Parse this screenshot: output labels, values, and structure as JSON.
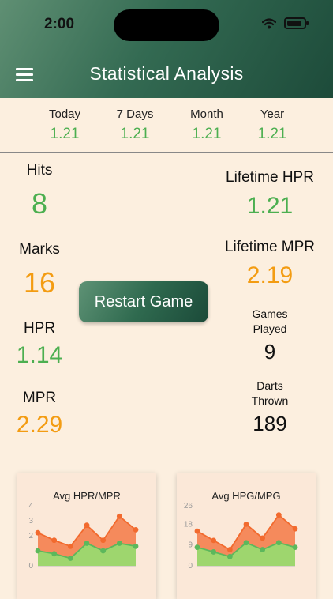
{
  "status": {
    "time": "2:00"
  },
  "header": {
    "title": "Statistical Analysis"
  },
  "periods": [
    {
      "label": "Today",
      "value": "1.21"
    },
    {
      "label": "7 Days",
      "value": "1.21"
    },
    {
      "label": "Month",
      "value": "1.21"
    },
    {
      "label": "Year",
      "value": "1.21"
    }
  ],
  "left_stats": {
    "hits": {
      "label": "Hits",
      "value": "8"
    },
    "marks": {
      "label": "Marks",
      "value": "16"
    },
    "hpr": {
      "label": "HPR",
      "value": "1.14"
    },
    "mpr": {
      "label": "MPR",
      "value": "2.29"
    }
  },
  "right_stats": {
    "lifetime_hpr": {
      "label": "Lifetime HPR",
      "value": "1.21"
    },
    "lifetime_mpr": {
      "label": "Lifetime MPR",
      "value": "2.19"
    },
    "games_played": {
      "label1": "Games",
      "label2": "Played",
      "value": "9"
    },
    "darts_thrown": {
      "label1": "Darts",
      "label2": "Thrown",
      "value": "189"
    }
  },
  "restart_label": "Restart Game",
  "colors": {
    "green": "#4caf50",
    "orange": "#f39c12",
    "series_orange": "#f26a2e",
    "series_green": "#5cb85c"
  },
  "chart_data": [
    {
      "type": "area",
      "title": "Avg HPR/MPR",
      "yticks": [
        "0",
        "2",
        "3",
        "4"
      ],
      "ylim": [
        0,
        4
      ],
      "series": [
        {
          "values": [
            2.2,
            1.7,
            1.3,
            2.7,
            1.7,
            3.3,
            2.4
          ]
        },
        {
          "values": [
            1.0,
            0.8,
            0.5,
            1.5,
            1.0,
            1.5,
            1.3
          ]
        }
      ]
    },
    {
      "type": "area",
      "title": "Avg HPG/MPG",
      "yticks": [
        "0",
        "9",
        "18",
        "26"
      ],
      "ylim": [
        0,
        26
      ],
      "series": [
        {
          "values": [
            15,
            11,
            7,
            18,
            12,
            22,
            16
          ]
        },
        {
          "values": [
            8,
            6,
            4,
            10,
            7,
            10,
            8
          ]
        }
      ]
    }
  ]
}
